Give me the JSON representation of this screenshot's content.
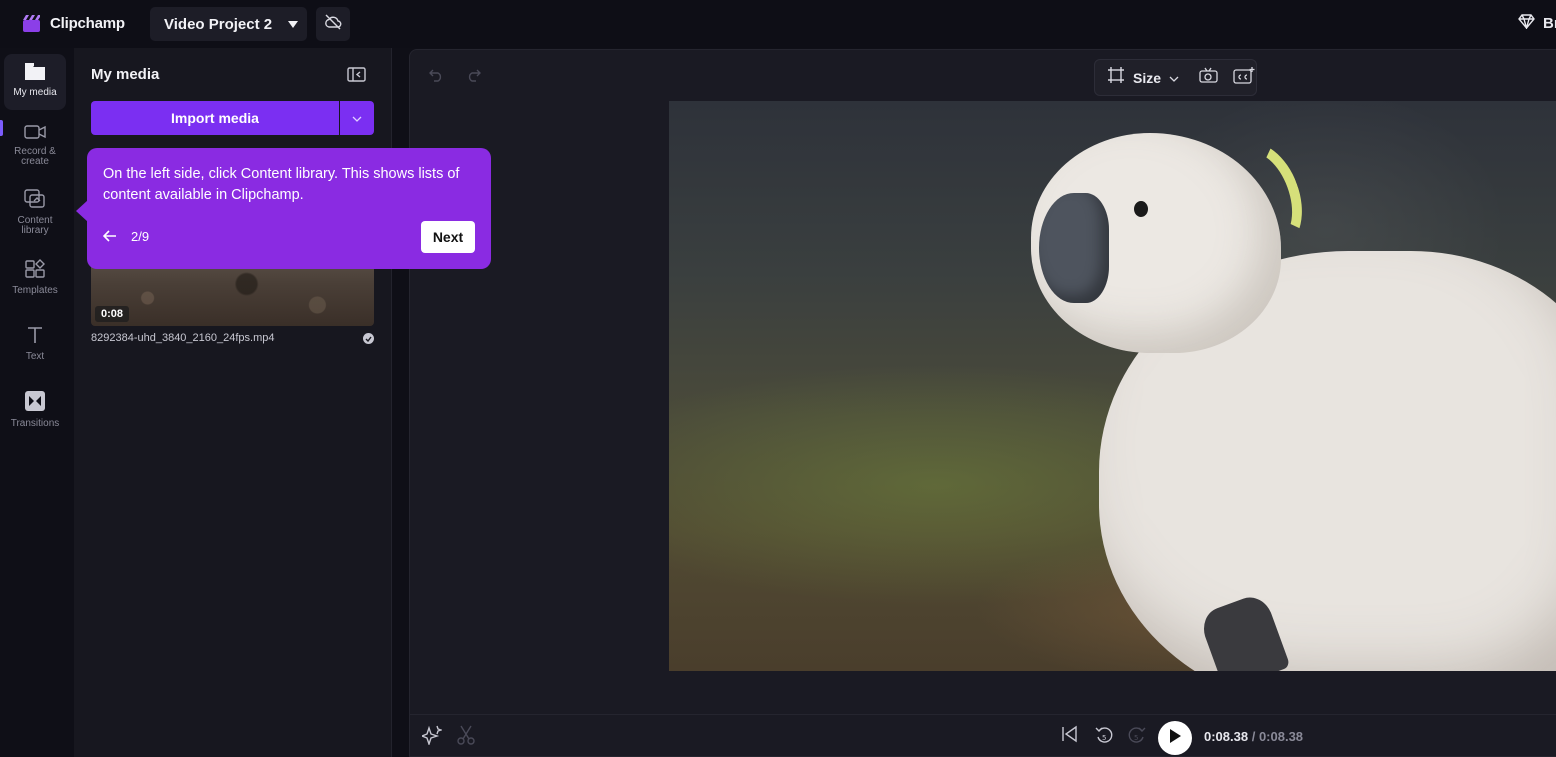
{
  "app": {
    "name": "Clipchamp",
    "brand_color": "#7b2ff2",
    "project_name": "Video Project 2",
    "upgrade_label": "Br"
  },
  "rail": {
    "items": [
      {
        "label": "My media",
        "icon": "folder-icon",
        "active": true
      },
      {
        "label": "Record & create",
        "icon": "camera-icon"
      },
      {
        "label": "Content library",
        "icon": "content-library-icon"
      },
      {
        "label": "Templates",
        "icon": "templates-icon"
      },
      {
        "label": "Text",
        "icon": "text-icon"
      },
      {
        "label": "Transitions",
        "icon": "transitions-icon"
      }
    ]
  },
  "panel": {
    "title": "My media",
    "import_label": "Import media",
    "media": [
      {
        "filename": "8292384-uhd_3840_2160_24fps.mp4",
        "duration": "0:08"
      }
    ]
  },
  "tooltip": {
    "text": "On the left side, click Content library. This shows lists of content available in Clipchamp.",
    "step": "2/9",
    "next_label": "Next",
    "color": "#8a2be2"
  },
  "stage": {
    "toolbar": {
      "size_label": "Size"
    },
    "playback": {
      "current": "0:08.38",
      "total": "/ 0:08.38"
    }
  }
}
